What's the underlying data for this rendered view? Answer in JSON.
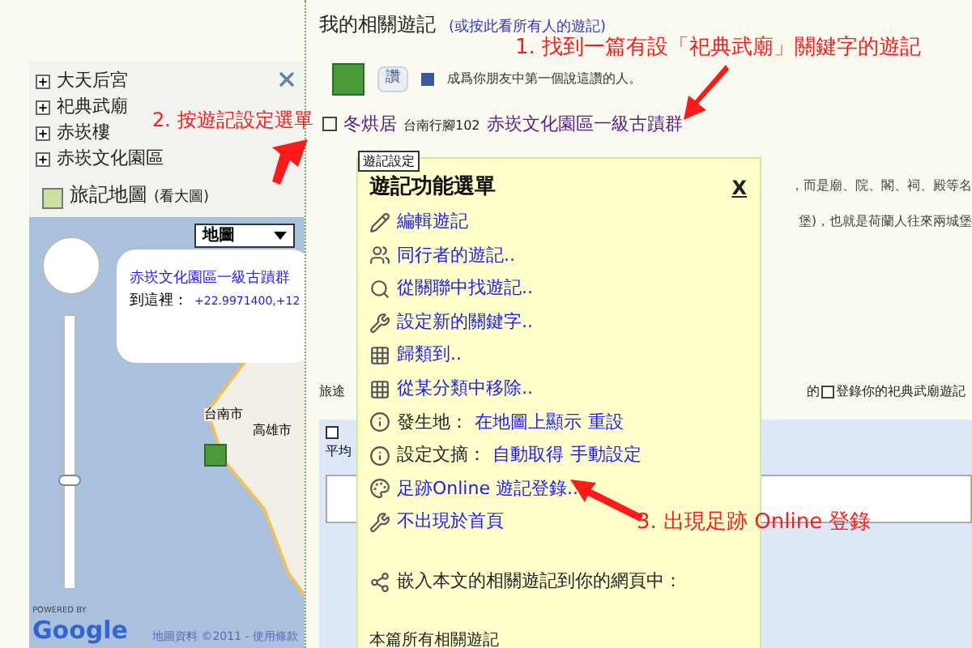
{
  "sidebar": {
    "tree": [
      {
        "label": "大天后宮",
        "expanded": false
      },
      {
        "label": "祀典武廟",
        "expanded": false
      },
      {
        "label": "赤崁樓",
        "expanded": false
      },
      {
        "label": "赤崁文化園區",
        "expanded": false
      }
    ],
    "zoom_slider": {
      "level": 0.4
    },
    "map_title": "旅記地圖",
    "map_link": "(看大圖)",
    "map_type": "地圖",
    "bubble_title": "赤崁文化園區一級古蹟群",
    "bubble_label": "到這裡：",
    "bubble_coords": "+22.9971400,+12",
    "city_1": "台南市",
    "city_2": "高雄市",
    "powered_by": "POWERED BY",
    "google": "Google",
    "map_credit": "地圖資料 ©2011 - 使用條款"
  },
  "main": {
    "heading": "我的相關遊記",
    "heading_link": "(或按此看所有人的遊記)",
    "like_button": "讚",
    "like_text": "成爲你朋友中第一個說這讚的人。",
    "entry": {
      "author": "冬烘居",
      "source": "台南行腳102",
      "title": "赤崁文化園區一級古蹟群"
    },
    "line_1": "，而是廟、院、閣、祠、殿等名",
    "line_2": "堡)，也就是荷蘭人往來兩城堡",
    "tip_start": "旅途",
    "tip_mid": "的",
    "tip_end": "登錄你的祀典武廟遊記",
    "panel_label": "平均"
  },
  "menu": {
    "tooltip": "遊記設定",
    "title": "遊記功能選單",
    "close": "X",
    "items": [
      {
        "kind": "link",
        "text": "編輯遊記"
      },
      {
        "kind": "link",
        "text": "同行者的遊記.."
      },
      {
        "kind": "link",
        "text": "從關聯中找遊記.."
      },
      {
        "kind": "link",
        "text": "設定新的關鍵字.."
      },
      {
        "kind": "link",
        "text": "歸類到.."
      },
      {
        "kind": "link",
        "text": "從某分類中移除.."
      },
      {
        "kind": "labeled",
        "text": "發生地：",
        "links": [
          "在地圖上顯示",
          "重設"
        ]
      },
      {
        "kind": "labeled",
        "text": "設定文摘：",
        "links": [
          "自動取得",
          "手動設定"
        ]
      },
      {
        "kind": "link",
        "text": "足跡Online 遊記登錄.."
      },
      {
        "kind": "link",
        "text": "不出現於首頁"
      },
      {
        "kind": "plain",
        "text": "嵌入本文的相關遊記到你的網頁中："
      },
      {
        "kind": "note",
        "text": "本篇所有相關遊記"
      }
    ]
  },
  "annotations": [
    "1. 找到一篇有設「祀典武廟」關鍵字的遊記",
    "2. 按遊記設定選單",
    "3. 出現足跡 Online 登錄"
  ]
}
